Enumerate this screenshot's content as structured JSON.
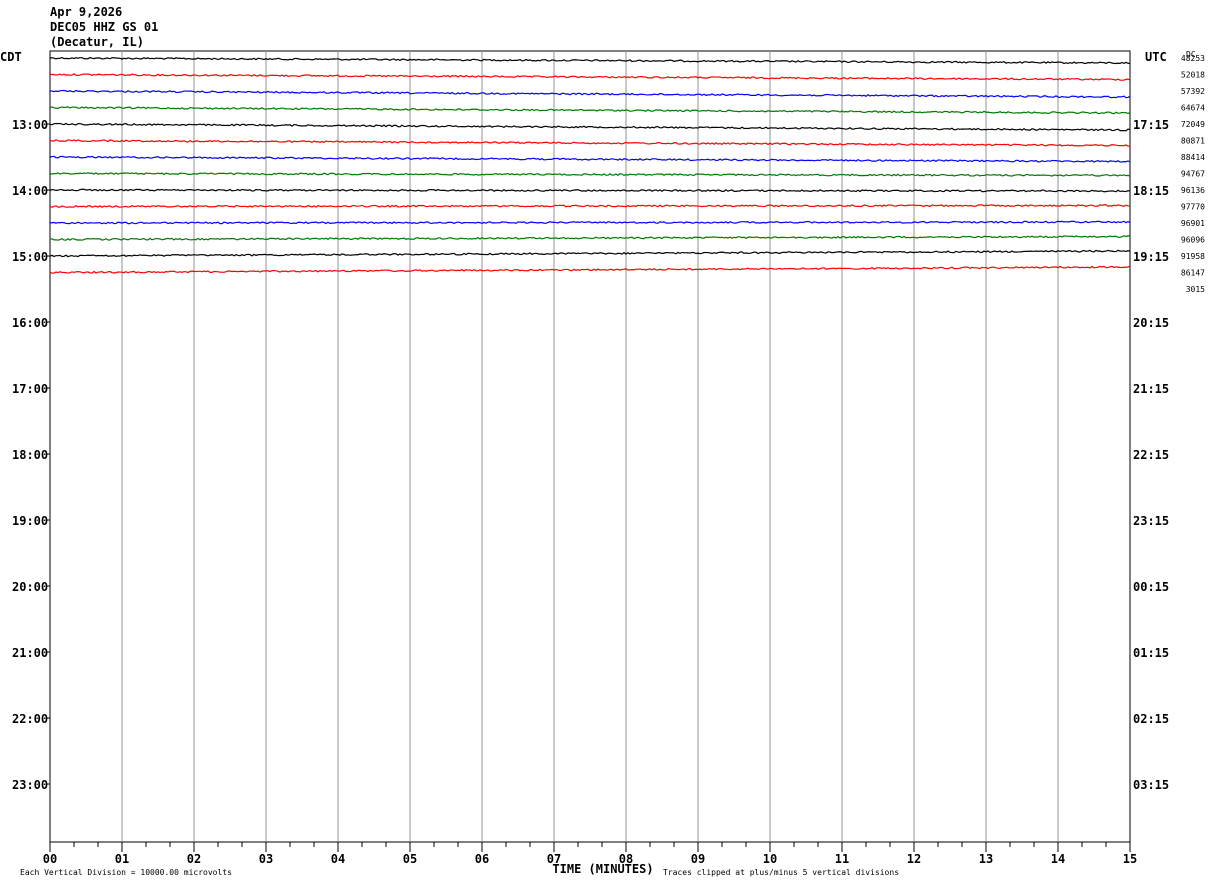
{
  "header": {
    "date": "Apr 9,2026",
    "station": "DEC05 HHZ GS 01",
    "location": "(Decatur, IL)"
  },
  "chart_data": {
    "type": "line",
    "left_axis_title": "CDT",
    "right_axis_title": "UTC",
    "dc_label": "DC",
    "left_time_labels": [
      "13:00",
      "14:00",
      "15:00",
      "16:00",
      "17:00",
      "18:00",
      "19:00",
      "20:00",
      "21:00",
      "22:00",
      "23:00"
    ],
    "right_time_labels": [
      "17:15",
      "18:15",
      "19:15",
      "20:15",
      "21:15",
      "22:15",
      "23:15",
      "00:15",
      "01:15",
      "02:15",
      "03:15"
    ],
    "x_tick_labels": [
      "00",
      "01",
      "02",
      "03",
      "04",
      "05",
      "06",
      "07",
      "08",
      "09",
      "10",
      "11",
      "12",
      "13",
      "14",
      "15"
    ],
    "x_axis_label": "TIME (MINUTES)",
    "xlim": [
      0,
      15
    ],
    "dc_offsets": [
      "48253",
      "52018",
      "57392",
      "64674",
      "72049",
      "80871",
      "88414",
      "94767",
      "96136",
      "97770",
      "96901",
      "96096",
      "91958",
      "86147",
      "3015"
    ],
    "trace_colors": [
      "#000000",
      "#ff0000",
      "#0000ff",
      "#007a00"
    ],
    "traces": [
      {
        "color": "#000000",
        "drift": 0.5
      },
      {
        "color": "#ff0000",
        "drift": 0.5
      },
      {
        "color": "#0000ff",
        "drift": 0.6
      },
      {
        "color": "#007a00",
        "drift": 0.55
      },
      {
        "color": "#000000",
        "drift": 0.6
      },
      {
        "color": "#ff0000",
        "drift": 0.5
      },
      {
        "color": "#0000ff",
        "drift": 0.45
      },
      {
        "color": "#007a00",
        "drift": 0.2
      },
      {
        "color": "#000000",
        "drift": 0.1
      },
      {
        "color": "#ff0000",
        "drift": -0.1
      },
      {
        "color": "#0000ff",
        "drift": -0.1
      },
      {
        "color": "#007a00",
        "drift": -0.3
      },
      {
        "color": "#000000",
        "drift": -0.5
      },
      {
        "color": "#ff0000",
        "drift": -0.55
      }
    ],
    "footer_left": "Each Vertical Division = 10000.00 microvolts",
    "footer_right": "Traces clipped at plus/minus 5 vertical divisions"
  }
}
